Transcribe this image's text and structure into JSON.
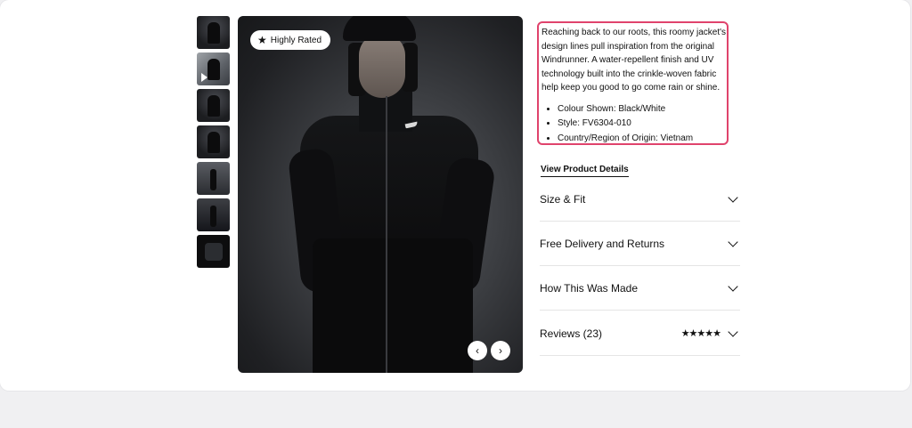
{
  "badge": {
    "label": "Highly Rated",
    "icon": "star-icon"
  },
  "thumbnails": [
    {
      "name": "thumbnail-1"
    },
    {
      "name": "thumbnail-2-video"
    },
    {
      "name": "thumbnail-3"
    },
    {
      "name": "thumbnail-4"
    },
    {
      "name": "thumbnail-5"
    },
    {
      "name": "thumbnail-6"
    },
    {
      "name": "thumbnail-7"
    }
  ],
  "description": {
    "text": "Reaching back to our roots, this roomy jacket's design lines pull inspiration from the original Windrunner. A water-repellent finish and UV technology built into the crinkle-woven fabric help keep you good to go come rain or shine.",
    "bullets": [
      "Colour Shown: Black/White",
      "Style: FV6304-010",
      "Country/Region of Origin: Vietnam"
    ]
  },
  "view_details_label": "View Product Details",
  "accordion": [
    {
      "label": "Size & Fit"
    },
    {
      "label": "Free Delivery and Returns"
    },
    {
      "label": "How This Was Made"
    },
    {
      "label": "Reviews (23)",
      "stars": "★★★★★"
    }
  ],
  "colors": {
    "highlight": "#e0436c",
    "text": "#111111",
    "background": "#f0f0f2"
  }
}
